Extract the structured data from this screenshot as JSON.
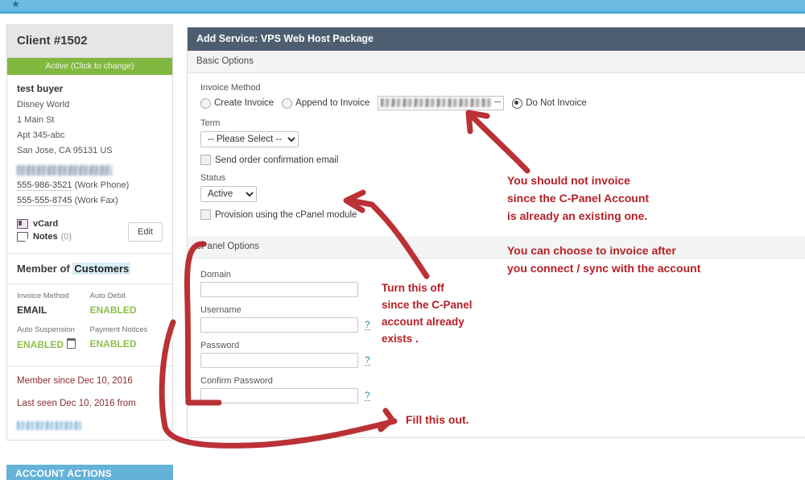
{
  "topbar": {
    "icon": "bookmark-star-icon"
  },
  "sidebar": {
    "client_title": "Client #1502",
    "status_label": "Active (Click to change)",
    "customer": {
      "name": "test buyer",
      "company": "Disney World",
      "address1": "1 Main St",
      "address2": "Apt 345-abc",
      "city_state_zip": "San Jose, CA 95131 US"
    },
    "phones": [
      {
        "number": "555-986-3521",
        "type": "(Work Phone)"
      },
      {
        "number": "555-555-8745",
        "type": "(Work Fax)"
      }
    ],
    "vcard_label": "vCard",
    "notes_label": "Notes",
    "notes_count": "(0)",
    "edit_label": "Edit",
    "member_of_prefix": "Member of",
    "member_of_group": "Customers",
    "details": [
      {
        "label": "Invoice Method",
        "value": "EMAIL",
        "green": false
      },
      {
        "label": "Auto Debit",
        "value": "ENABLED",
        "green": true
      },
      {
        "label": "Auto Suspension",
        "value": "ENABLED",
        "green": true
      },
      {
        "label": "Payment Notices",
        "value": "ENABLED",
        "green": true
      }
    ],
    "member_since": "Member since Dec 10, 2016",
    "last_seen": "Last seen Dec 10, 2016 from",
    "account_actions": "ACCOUNT ACTIONS"
  },
  "panel": {
    "title": "Add Service: VPS Web Host Package",
    "basic_section": "Basic Options",
    "invoice_method_label": "Invoice Method",
    "invoice_options": {
      "create": "Create Invoice",
      "append": "Append to Invoice",
      "do_not": "Do Not Invoice",
      "selected": "Do Not Invoice"
    },
    "term_label": "Term",
    "term_value": "-- Please Select --",
    "term_options": [
      "-- Please Select --"
    ],
    "send_confirmation_label": "Send order confirmation email",
    "status_label": "Status",
    "status_value": "Active",
    "status_options": [
      "Active"
    ],
    "provision_label": "Provision using the cPanel module",
    "cpanel_section": "cPanel Options",
    "cpanel_fields": [
      {
        "label": "Domain",
        "value": "",
        "help": ""
      },
      {
        "label": "Username",
        "value": "",
        "help": "?"
      },
      {
        "label": "Password",
        "value": "",
        "help": "?"
      },
      {
        "label": "Confirm Password",
        "value": "",
        "help": "?"
      }
    ]
  },
  "annotations": {
    "note1": "You should not invoice\nsince the C-Panel Account\nis already an existing one.",
    "note2": "You can choose to invoice after\nyou connect / sync with the account",
    "note3": "Turn this off\nsince the C-Panel\naccount already\nexists .",
    "note4": "Fill this out.",
    "ink_color": "#b52026"
  }
}
